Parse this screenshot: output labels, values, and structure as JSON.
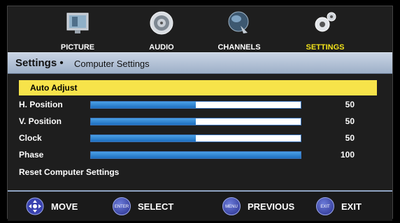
{
  "nav": {
    "items": [
      {
        "label": "PICTURE",
        "icon": "picture-icon",
        "active": false
      },
      {
        "label": "AUDIO",
        "icon": "speaker-icon",
        "active": false
      },
      {
        "label": "CHANNELS",
        "icon": "satellite-dish-icon",
        "active": false
      },
      {
        "label": "SETTINGS",
        "icon": "gears-icon",
        "active": true
      }
    ]
  },
  "header": {
    "title": "Settings •",
    "subtitle": "Computer Settings"
  },
  "rows": [
    {
      "label": "Auto Adjust",
      "selected": true
    },
    {
      "label": "H. Position",
      "value": "50",
      "level": 0.5
    },
    {
      "label": "V. Position",
      "value": "50",
      "level": 0.5
    },
    {
      "label": "Clock",
      "value": "50",
      "level": 0.5
    },
    {
      "label": "Phase",
      "value": "100",
      "level": 1.0
    },
    {
      "label": "Reset Computer Settings"
    }
  ],
  "footer": {
    "move": {
      "badge": "",
      "label": "MOVE"
    },
    "select": {
      "badge": "ENTER",
      "label": "SELECT"
    },
    "previous": {
      "badge": "MENU",
      "label": "PREVIOUS"
    },
    "exit": {
      "badge": "EXIT",
      "label": "EXIT"
    }
  },
  "colors": {
    "accent": "#f2e21a",
    "highlight": "#f7e34a",
    "slider": "#2a7fd0",
    "badge": "#3a43b0"
  }
}
